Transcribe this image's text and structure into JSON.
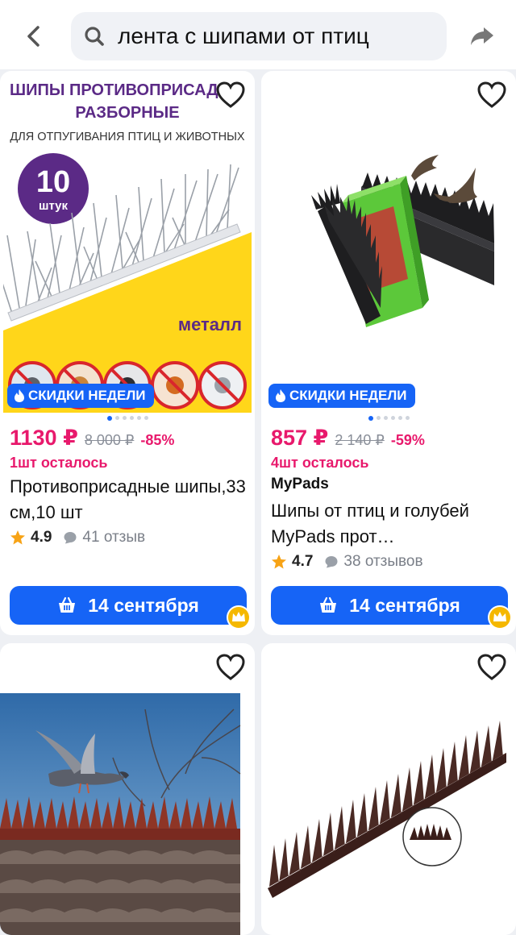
{
  "header": {
    "search_value": "лента с шипами от птиц",
    "icons": [
      "back-arrow-icon",
      "search-icon",
      "share-icon"
    ]
  },
  "products": [
    {
      "image_text": {
        "headline1": "ШИПЫ ПРОТИВОПРИСАДН",
        "headline2": "РАЗБОРНЫЕ",
        "sub": "ДЛЯ ОТПУГИВАНИЯ ПТИЦ И ЖИВОТНЫХ",
        "count_num": "10",
        "count_word": "штук",
        "material": "металл"
      },
      "sale_badge": "СКИДКИ НЕДЕЛИ",
      "price": "1130 ₽",
      "old_price": "8 000 ₽",
      "discount": "-85%",
      "stock": "1шт осталось",
      "title": "Противоприсадные шипы,33 см,10 шт",
      "rating": "4.9",
      "reviews": "41 отзыв",
      "delivery": "14 сентября"
    },
    {
      "sale_badge": "СКИДКИ НЕДЕЛИ",
      "price": "857 ₽",
      "old_price": "2 140 ₽",
      "discount": "-59%",
      "stock": "4шт осталось",
      "brand": "MyPads",
      "title": "Шипы от птиц и голубей MyPads прот…",
      "rating": "4.7",
      "reviews": "38 отзывов",
      "delivery": "14 сентября"
    }
  ],
  "colors": {
    "accent": "#1664f6",
    "price": "#e8196c",
    "banner_purple": "#5b2a86",
    "banner_yellow": "#ffd61a"
  }
}
